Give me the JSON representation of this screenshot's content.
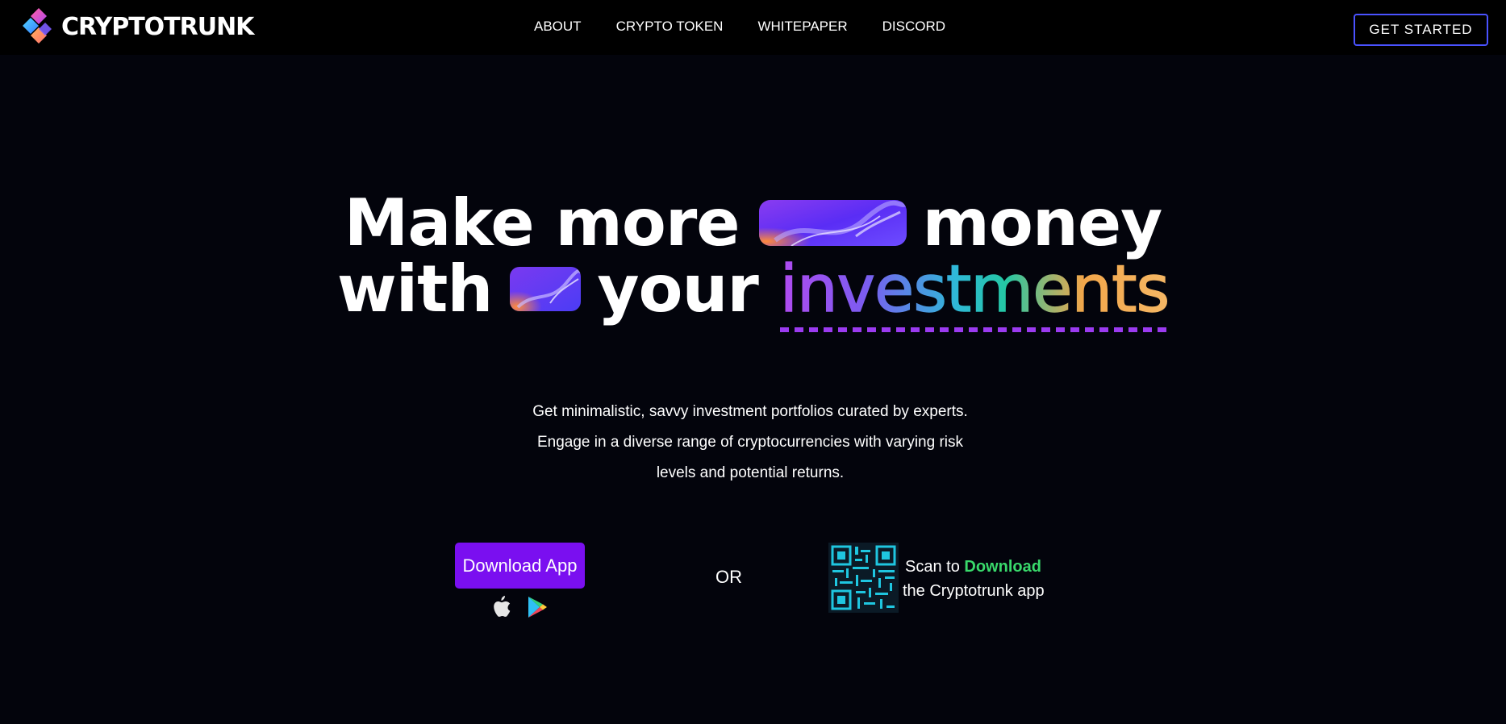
{
  "brand": {
    "name": "CRYPTOTRUNK"
  },
  "nav": {
    "items": [
      {
        "label": "ABOUT"
      },
      {
        "label": "CRYPTO TOKEN"
      },
      {
        "label": "WHITEPAPER"
      },
      {
        "label": "DISCORD"
      }
    ],
    "cta_label": "GET STARTED"
  },
  "hero": {
    "line1_a": "Make more",
    "line1_b": "money",
    "line2_a": "with",
    "line2_b": "your",
    "highlight": "investments"
  },
  "subtitle": {
    "line1": "Get minimalistic, savvy investment portfolios curated by experts.",
    "line2": "Engage in a diverse range of cryptocurrencies with varying risk",
    "line3": "levels and potential returns."
  },
  "download": {
    "button_label": "Download App",
    "icons": [
      "apple-icon",
      "google-play-icon"
    ]
  },
  "or_label": "OR",
  "scan": {
    "prefix": "Scan to",
    "highlight": "Download",
    "line2": "the Cryptotrunk app"
  },
  "colors": {
    "background": "#03040c",
    "topbar": "#000000",
    "accent_purple": "#7a0ff0",
    "cta_border": "#4a52ff",
    "download_highlight": "#39d96b",
    "qr_cyan": "#1fc6e0"
  }
}
